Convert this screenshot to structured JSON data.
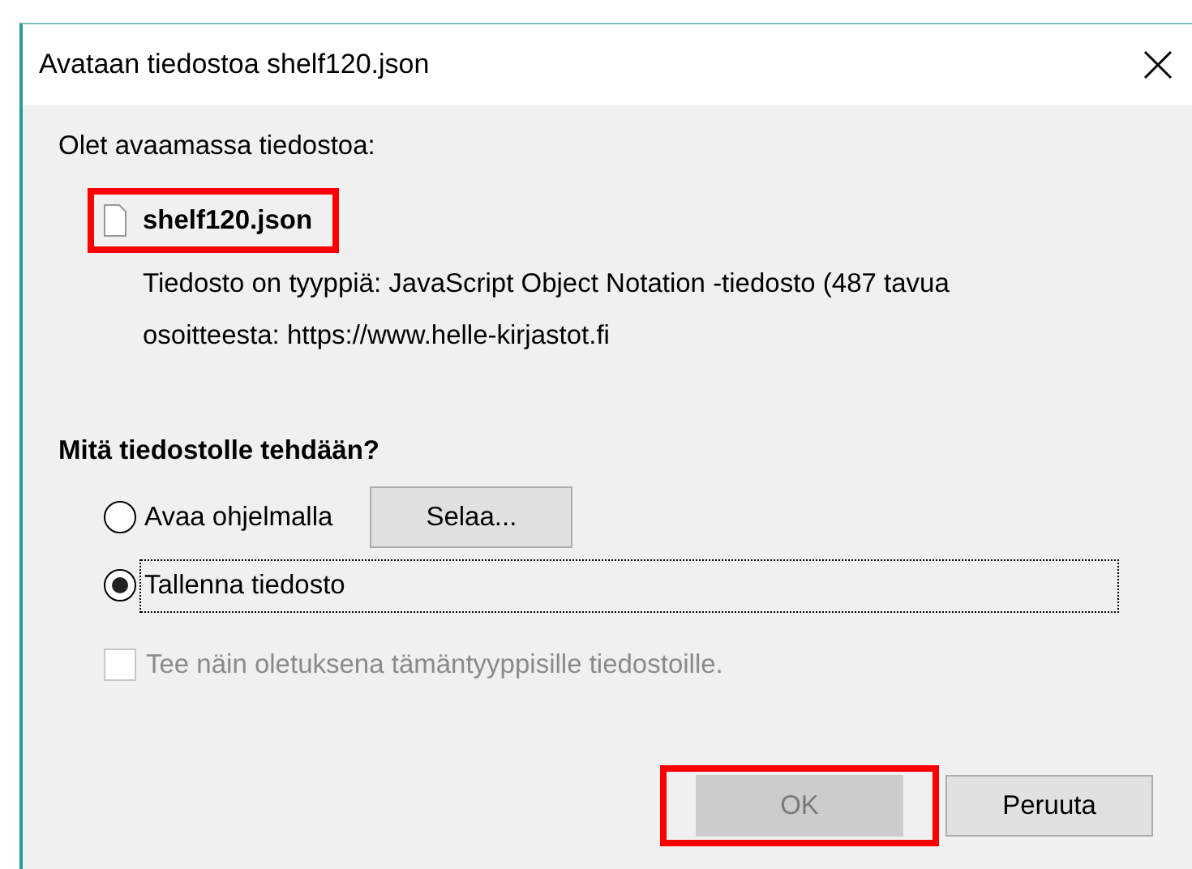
{
  "dialog": {
    "title": "Avataan tiedostoa shelf120.json",
    "intro": "Olet avaamassa tiedostoa:",
    "file": {
      "name": "shelf120.json",
      "highlighted": true
    },
    "type_line": "Tiedosto on tyyppiä: JavaScript Object Notation -tiedosto (487 tavua",
    "source_line": "osoitteesta: https://www.helle-kirjastot.fi",
    "question": "Mitä tiedostolle tehdään?",
    "options": [
      {
        "label": "Avaa ohjelmalla",
        "selected": false,
        "focused": false,
        "browse": "Selaa..."
      },
      {
        "label": "Tallenna tiedosto",
        "selected": true,
        "focused": true
      }
    ],
    "default_checkbox": {
      "label": "Tee näin oletuksena tämäntyyppisille tiedostoille.",
      "checked": false,
      "disabled": true
    },
    "buttons": [
      {
        "label": "OK",
        "disabled": true,
        "highlighted": true
      },
      {
        "label": "Peruuta",
        "disabled": false,
        "highlighted": false
      }
    ]
  }
}
